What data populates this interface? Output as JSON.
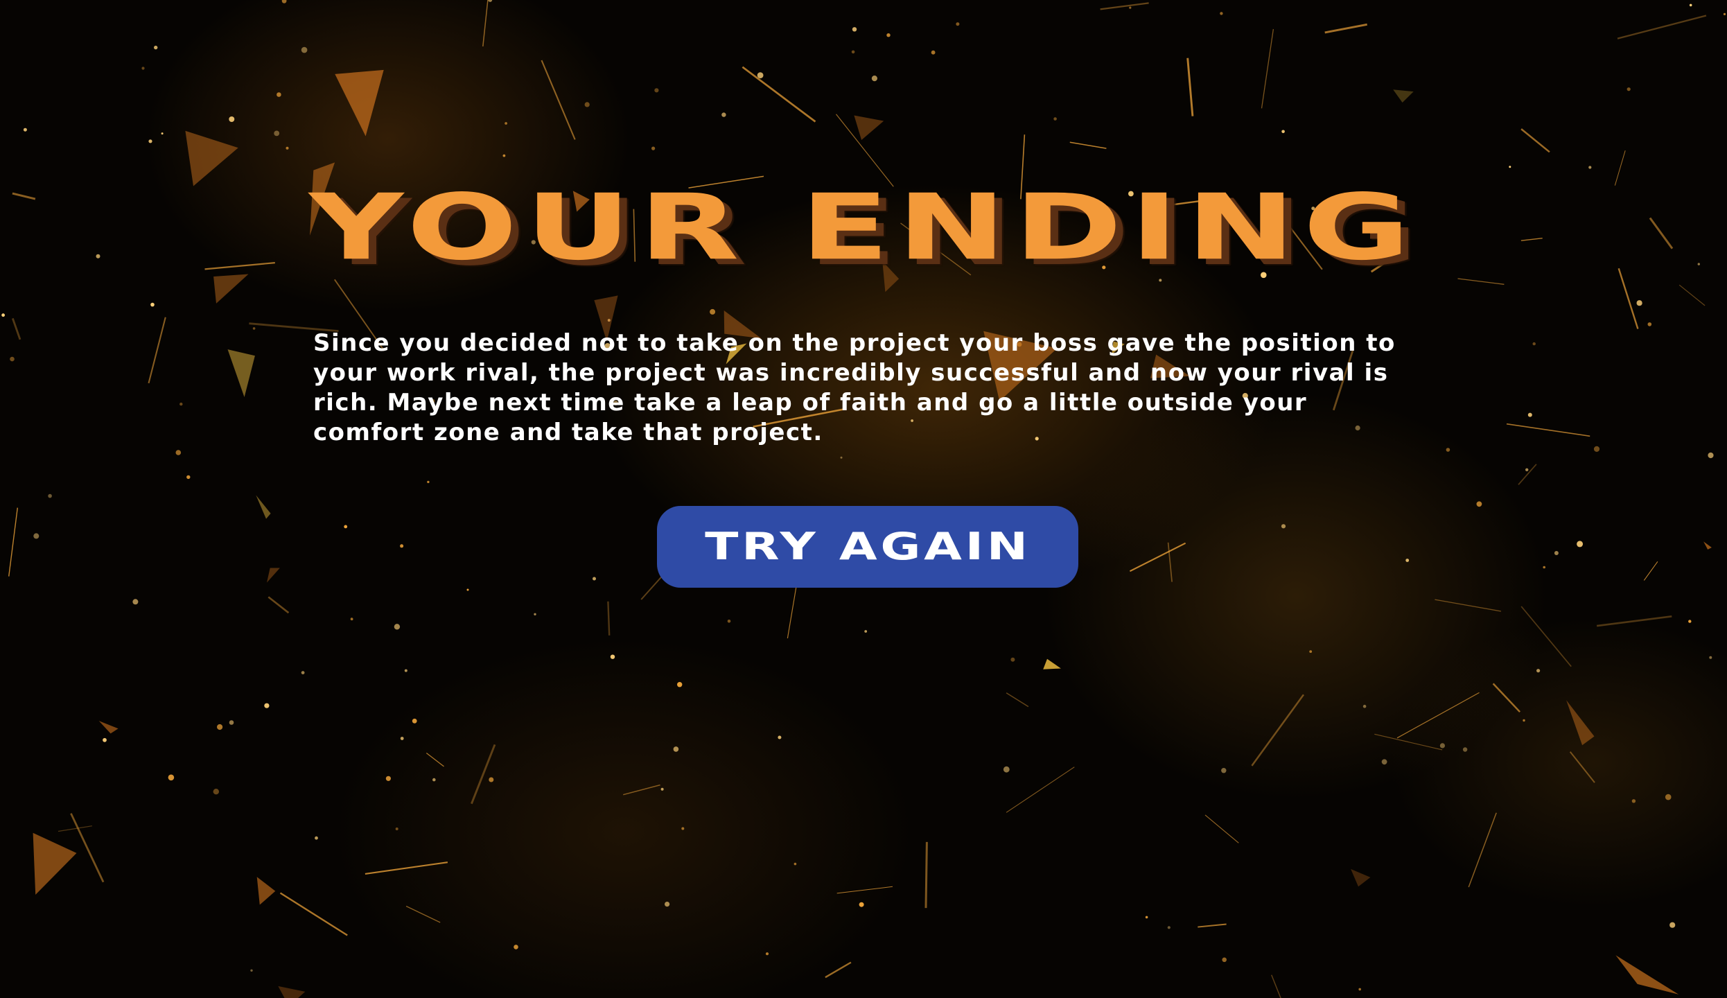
{
  "ending": {
    "title": "YOUR ENDING",
    "description": "Since you decided not to take on the project your boss gave the position to your work rival, the project was incredibly successful and now your rival is rich. Maybe next time take a leap of faith and go a little outside your comfort zone and take that project.",
    "try_again_label": "TRY AGAIN"
  },
  "colors": {
    "title": "#f39a3a",
    "title_shadow": "#5a2f14",
    "button": "#2f4ba6",
    "text": "#ffffff",
    "particle": "#f0a53a",
    "background": "#060402"
  }
}
